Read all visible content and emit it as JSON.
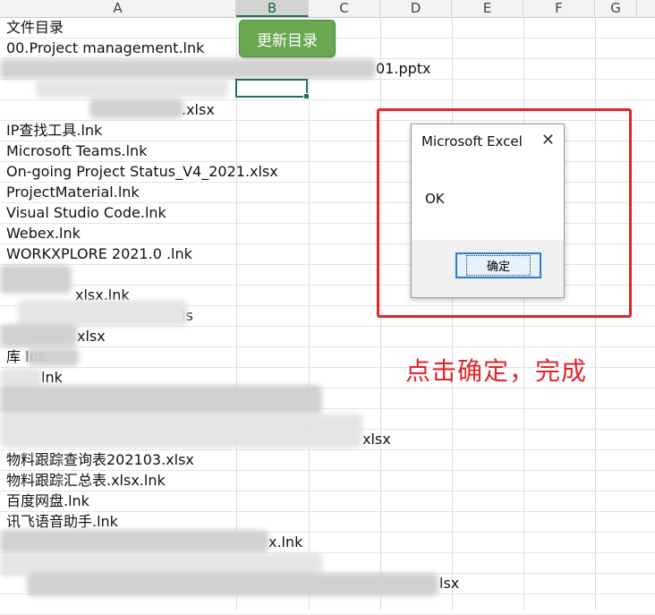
{
  "columns": [
    "A",
    "B",
    "C",
    "D",
    "E",
    "F",
    "G"
  ],
  "selected_column": "B",
  "rows": [
    "文件目录",
    "00.Project management.lnk",
    "01.pptx",
    "",
    ".xlsx",
    "IP查找工具.lnk",
    "Microsoft Teams.lnk",
    "On-going Project Status_V4_2021.xlsx",
    "ProjectMaterial.lnk",
    "Visual Studio Code.lnk",
    "Webex.lnk",
    "WORKXPLORE 2021.0  .lnk",
    "",
    "xlsx.lnk",
    "ls",
    "xlsx",
    "库 lnk",
    "lnk",
    "",
    "",
    "xlsx",
    "物料跟踪查询表202103.xlsx",
    "物料跟踪汇总表.xlsx.lnk",
    "百度网盘.lnk",
    "讯飞语音助手.lnk",
    "x.lnk",
    "",
    "lsx"
  ],
  "update_button": "更新目录",
  "dialog": {
    "title": "Microsoft Excel",
    "close_glyph": "✕",
    "message": "OK",
    "ok_label": "确定"
  },
  "annotation": "点击确定，完成",
  "colors": {
    "excel_green": "#217346",
    "button_green": "#6aa84f",
    "highlight_red": "#e3242b"
  }
}
